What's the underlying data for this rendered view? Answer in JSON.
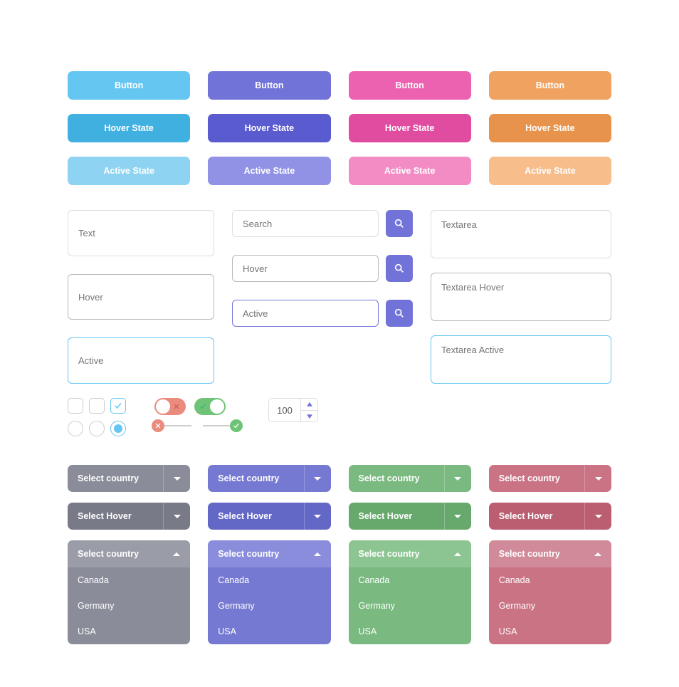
{
  "buttons": {
    "normal": "Button",
    "hover": "Hover State",
    "active": "Active State"
  },
  "inputs": {
    "text": "Text",
    "search": "Search",
    "hover": "Hover",
    "active": "Active"
  },
  "textarea": {
    "normal": "Textarea",
    "hover": "Textarea Hover",
    "active": "Textarea Active"
  },
  "stepper": {
    "value": "100"
  },
  "selects": {
    "normal": "Select country",
    "hover": "Select Hover",
    "open_label": "Select country",
    "options": [
      "Canada",
      "Germany",
      "USA"
    ]
  },
  "colors": {
    "blue": "#64c6f1",
    "purple": "#7273d9",
    "pink": "#ec62b0",
    "orange": "#f0a360",
    "gray": "#8a8d99",
    "green": "#7ab97f",
    "rose": "#c97385",
    "toggle_off": "#ea8b7e",
    "toggle_on": "#6fc376"
  }
}
